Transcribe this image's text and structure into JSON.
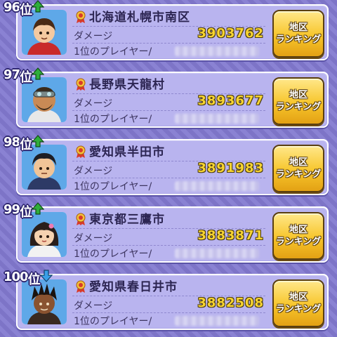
{
  "rank_suffix": "位",
  "damage_label": "ダメージ",
  "player_label": "1位のプレイヤー/",
  "button_line1": "地区",
  "button_line2": "ランキング",
  "entries": [
    {
      "rank": "96",
      "trend": "up",
      "region": "北海道札幌市南区",
      "damage": "3903762",
      "avatar": "boy-red-jacket"
    },
    {
      "rank": "97",
      "trend": "up",
      "region": "長野県天龍村",
      "damage": "3893677",
      "avatar": "man-goggles"
    },
    {
      "rank": "98",
      "trend": "up",
      "region": "愛知県半田市",
      "damage": "3891983",
      "avatar": "man-dark-hair"
    },
    {
      "rank": "99",
      "trend": "up",
      "region": "東京都三鷹市",
      "damage": "3883871",
      "avatar": "girl-hair-clip"
    },
    {
      "rank": "100",
      "trend": "down",
      "region": "愛知県春日井市",
      "damage": "3882508",
      "avatar": "boy-dreadlocks"
    }
  ],
  "colors": {
    "trend_up": "#2fae3b",
    "trend_down": "#3aa0e8",
    "damage": "#f7d431",
    "button": "#f7c52b"
  }
}
